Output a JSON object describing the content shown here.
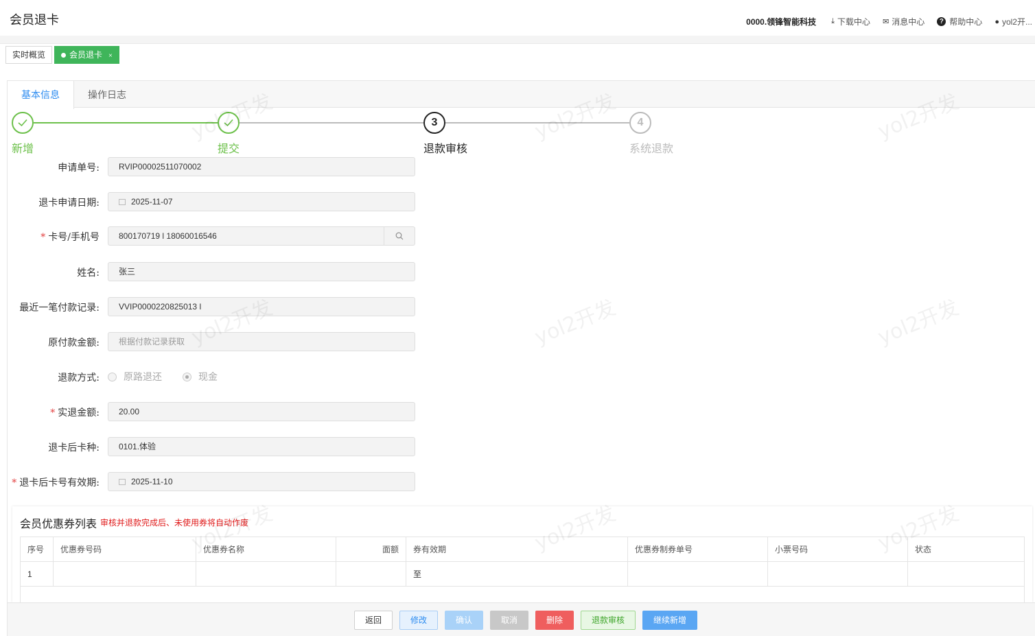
{
  "header": {
    "title": "会员退卡",
    "company": "0000.领锋智能科技",
    "download": "下载中心",
    "messages": "消息中心",
    "help": "帮助中心",
    "user": "yol2开..."
  },
  "page_tabs": [
    {
      "label": "实时概览"
    },
    {
      "label": "会员退卡",
      "close": "×"
    }
  ],
  "sub_tabs": [
    {
      "label": "基本信息"
    },
    {
      "label": "操作日志"
    }
  ],
  "steps": [
    {
      "label": "新增",
      "state": "done"
    },
    {
      "label": "提交",
      "state": "done"
    },
    {
      "label": "退款审核",
      "number": "3",
      "state": "current"
    },
    {
      "label": "系统退款",
      "number": "4",
      "state": "pending"
    }
  ],
  "form": {
    "order_no": {
      "label": "申请单号:",
      "value": "RVIP00002511070002"
    },
    "apply_date": {
      "label": "退卡申请日期:",
      "value": "2025-11-07"
    },
    "card_phone": {
      "label": "卡号/手机号",
      "value": "800170719 l 18060016546"
    },
    "name": {
      "label": "姓名:",
      "value": "张三"
    },
    "last_payment": {
      "label": "最近一笔付款记录:",
      "value": "VVIP0000220825013 l"
    },
    "original_amount": {
      "label": "原付款金额:",
      "placeholder": "根据付款记录获取"
    },
    "refund_method": {
      "label": "退款方式:",
      "option1": "原路退还",
      "option2": "现金",
      "selected": "现金"
    },
    "actual_refund": {
      "label": "实退金额:",
      "value": "20.00"
    },
    "card_type_after": {
      "label": "退卡后卡种:",
      "value": "0101.体验"
    },
    "valid_after": {
      "label": "退卡后卡号有效期:",
      "value": "2025-11-10"
    }
  },
  "coupons": {
    "title": "会员优惠券列表",
    "note": "审核并退款完成后、未使用券将自动作废",
    "columns": [
      "序号",
      "优惠券号码",
      "优惠券名称",
      "面额",
      "券有效期",
      "优惠券制券单号",
      "小票号码",
      "状态"
    ],
    "rows": [
      [
        "1",
        "",
        "",
        "",
        "至",
        "",
        "",
        ""
      ]
    ]
  },
  "buttons": {
    "back": "返回",
    "edit": "修改",
    "confirm": "确认",
    "cancel": "取消",
    "delete": "删除",
    "audit": "退款审核",
    "new": "继续新增"
  },
  "watermark": "yol2开发",
  "colors": {
    "success": "#6cc04a",
    "primary": "#2d8cf0",
    "danger": "#ef5e5e",
    "tab_active": "#3fb55a"
  }
}
